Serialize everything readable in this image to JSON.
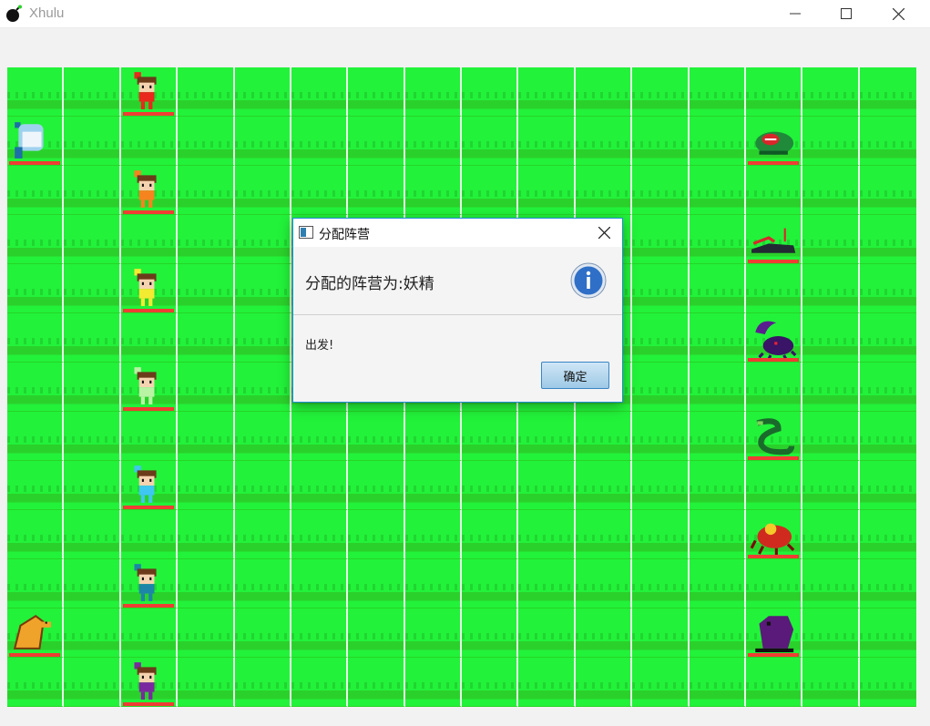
{
  "window": {
    "title": "Xhulu",
    "app_icon": "bomb-icon",
    "controls": [
      "minimize-icon",
      "maximize-icon",
      "close-icon"
    ]
  },
  "board": {
    "cols": 16,
    "rows": 13,
    "units": [
      {
        "row": 0,
        "col": 2,
        "kind": "calabash-brother",
        "color": "#e8291c"
      },
      {
        "row": 1,
        "col": 0,
        "kind": "grandpa",
        "color": "#9fd2ee"
      },
      {
        "row": 1,
        "col": 13,
        "kind": "frog-monster",
        "color": "#1f8a3a"
      },
      {
        "row": 2,
        "col": 2,
        "kind": "calabash-brother",
        "color": "#f5841f"
      },
      {
        "row": 3,
        "col": 13,
        "kind": "crocodile-monster",
        "color": "#222b33"
      },
      {
        "row": 4,
        "col": 2,
        "kind": "calabash-brother",
        "color": "#f3ea32"
      },
      {
        "row": 5,
        "col": 13,
        "kind": "scorpion-monster",
        "color": "#5a1f8f"
      },
      {
        "row": 6,
        "col": 2,
        "kind": "calabash-brother",
        "color": "#b9f3a4"
      },
      {
        "row": 7,
        "col": 13,
        "kind": "snake-monster",
        "color": "#1a6b2b"
      },
      {
        "row": 8,
        "col": 2,
        "kind": "calabash-brother",
        "color": "#3fc6f1"
      },
      {
        "row": 9,
        "col": 13,
        "kind": "centipede-monster",
        "color": "#d02a1f"
      },
      {
        "row": 10,
        "col": 2,
        "kind": "calabash-brother",
        "color": "#1d86a8"
      },
      {
        "row": 11,
        "col": 0,
        "kind": "pangolin",
        "color": "#f0a32a"
      },
      {
        "row": 11,
        "col": 13,
        "kind": "bat-monster",
        "color": "#5a1a7a"
      },
      {
        "row": 12,
        "col": 2,
        "kind": "calabash-brother",
        "color": "#7a2a9e"
      }
    ]
  },
  "dialog": {
    "title": "分配阵营",
    "header": "分配的阵营为:妖精",
    "body": "出发!",
    "ok_label": "确定",
    "header_icon": "info-icon"
  }
}
